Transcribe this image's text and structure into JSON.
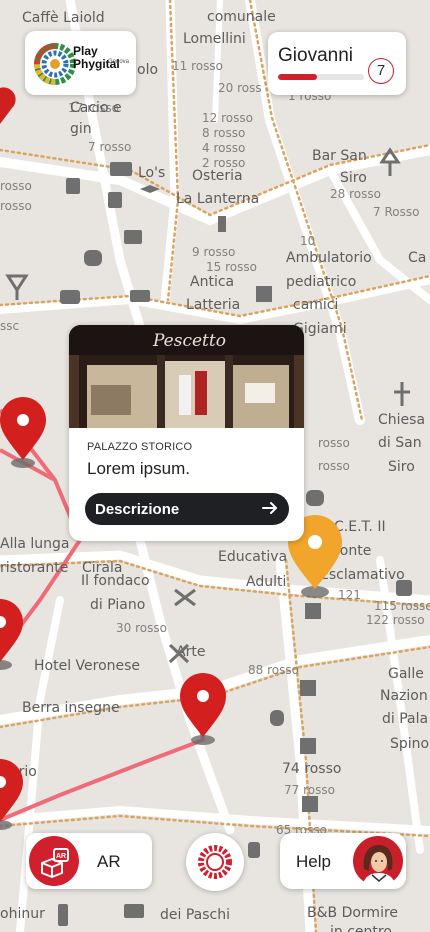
{
  "app": {
    "logo_text_line1": "Play",
    "logo_text_line2": "Phygital",
    "logo_text_sub": "Genova"
  },
  "user": {
    "name": "Giovanni",
    "level": "7",
    "progress": 0.45,
    "progress_color": "#d0202e"
  },
  "poi_card": {
    "image_sign": "Pescetto",
    "category": "PALAZZO STORICO",
    "title": "Lorem ipsum.",
    "button_label": "Descrizione",
    "button_icon": "arrow-right-icon"
  },
  "bottom_bar": {
    "ar_label": "AR",
    "ar_icon": "ar-cube-icon",
    "center_icon": "red-ring-icon",
    "help_label": "Help",
    "help_icon": "guide-avatar-icon"
  },
  "colors": {
    "accent": "#d0202e",
    "pin_red": "#cf1f1f",
    "pin_orange": "#f1a52b",
    "route": "#f06b78",
    "button_dark": "#1e2024"
  },
  "map_labels": [
    "Caffè Laiold",
    "comunale",
    "Lomellini",
    "olo",
    "11 rosso",
    "20 ross",
    "17 rosso",
    "Cacio e",
    "gin",
    "7 rosso",
    "12 rosso",
    "8 rosso",
    "4 rosso",
    "2 rosso",
    "Lo's",
    "Osteria",
    "La Lanterna",
    "1 rosso",
    "rosso",
    "Bar San",
    "Siro",
    "28 rosso",
    "7 Rosso",
    "9 rosso",
    "15 rosso",
    "10",
    "Ambulatorio",
    "pediatrico",
    "camici",
    "Antica",
    "Latteria",
    "Gigiami",
    "Ca",
    "ssc",
    "Chiesa",
    "di San",
    "Siro",
    "rosso",
    "rosso",
    "C.E.T. II",
    "Educativa",
    "Conte",
    "Adulti",
    "Esclamativo",
    "121",
    "115 rosso",
    "122 rosso",
    "Alla lunga",
    "ristorante",
    "Cirala",
    "Il fondaco",
    "di Piano",
    "30 rosso",
    "Arte",
    "Hotel Veronese",
    "88 rosso",
    "Berra insegne",
    "Galle",
    "Nazion",
    "di Pala",
    "Spino",
    "74 rosso",
    "77 rosso",
    "65 rosso",
    "dei Paschi",
    "B&B Dormire",
    "in centro",
    "ohinur",
    "ario",
    "ssc",
    "rosso"
  ]
}
